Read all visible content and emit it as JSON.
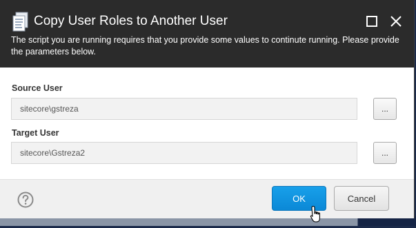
{
  "dialog": {
    "title": "Copy User Roles to Another User",
    "subtitle": "The script you are running requires that you provide some values to continute running. Please provide the parameters below.",
    "icons": {
      "app": "scroll-document-icon",
      "maximize": "maximize-icon",
      "close": "close-icon"
    }
  },
  "form": {
    "source_user": {
      "label": "Source User",
      "value": "sitecore\\gstreza",
      "browse_label": "..."
    },
    "target_user": {
      "label": "Target User",
      "value": "sitecore\\Gstreza2",
      "browse_label": "..."
    }
  },
  "footer": {
    "help_icon": "help-icon",
    "ok_label": "OK",
    "cancel_label": "Cancel"
  },
  "colors": {
    "header_bg": "#2b2b2b",
    "primary_button": "#0b8fdf",
    "footer_bg": "#f0f0f0"
  }
}
